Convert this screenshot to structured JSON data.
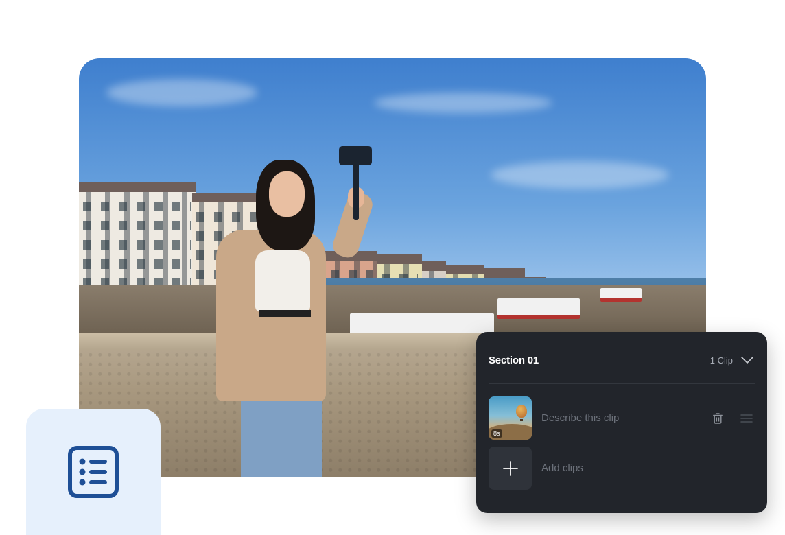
{
  "hero": {
    "alt": "Woman taking a selfie on a bridge over a river with colorful buildings"
  },
  "icon_card": {
    "icon": "list-icon",
    "accent": "#1e4f96",
    "background": "#e6f0fc"
  },
  "panel": {
    "section_title": "Section 01",
    "clip_count": "1 Clip",
    "clips": [
      {
        "duration": "8s",
        "placeholder": "Describe this clip"
      }
    ],
    "add_label": "Add clips",
    "colors": {
      "background": "#22252b",
      "muted_text": "#6c717a",
      "add_button": "#2f333a"
    }
  }
}
